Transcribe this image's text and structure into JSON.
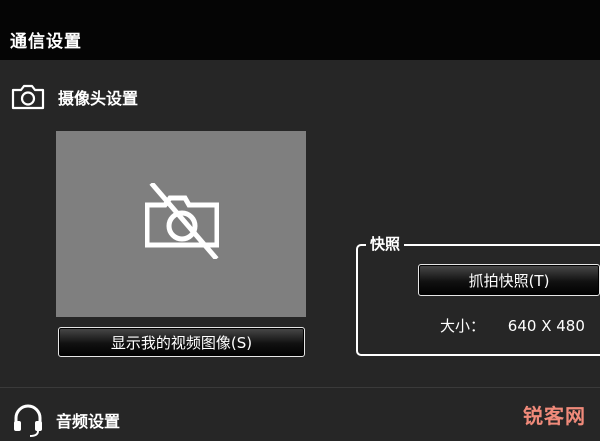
{
  "window": {
    "title": "通信设置"
  },
  "camera_section": {
    "icon": "camera-icon",
    "title": "摄像头设置",
    "preview_icon": "camera-off-icon",
    "show_video_button": "显示我的视频图像(S)"
  },
  "snapshot_group": {
    "legend": "快照",
    "snapshot_button": "抓拍快照(T)",
    "size_label": "大小：",
    "size_value": "640 X 480"
  },
  "audio_section": {
    "icon": "headset-icon",
    "title": "音频设置"
  },
  "watermark": {
    "text": "锐客网"
  },
  "colors": {
    "title_bar": "#050505",
    "background": "#262626",
    "preview_bg": "#7f7f7f",
    "text": "#ffffff",
    "watermark": "#f08a7a"
  }
}
